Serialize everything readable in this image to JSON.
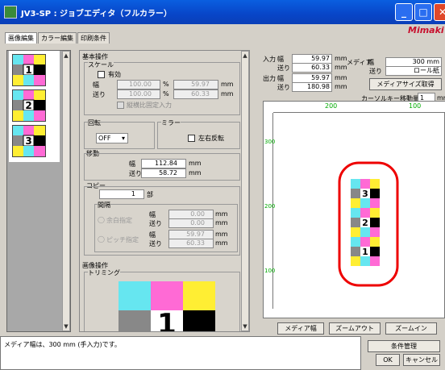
{
  "window": {
    "title": "JV3-SP : ジョブエディタ（フルカラー）",
    "logo": "Mimaki"
  },
  "tabs": [
    {
      "label": "画像編集"
    },
    {
      "label": "カラー編集"
    },
    {
      "label": "印刷条件"
    }
  ],
  "thumbnails": [
    {
      "label": "1"
    },
    {
      "label": "2"
    },
    {
      "label": "3"
    }
  ],
  "basic": {
    "section_title": "基本操作",
    "scale": {
      "title": "スケール",
      "enabled_label": "有効",
      "width_label": "幅",
      "feed_label": "送り",
      "width_pct": "100.00",
      "feed_pct": "100.00",
      "width_mm": "59.97",
      "feed_mm": "60.33",
      "pct_unit": "%",
      "mm_unit": "mm",
      "fixed_ratio_label": "縦横比固定入力"
    },
    "rotate": {
      "title": "回転",
      "value": "OFF"
    },
    "mirror": {
      "title": "ミラー",
      "label": "左右反転"
    },
    "move": {
      "title": "移動",
      "width_label": "幅",
      "feed_label": "送り",
      "width_value": "112.84",
      "feed_value": "58.72",
      "unit": "mm"
    },
    "copy": {
      "title": "コピー",
      "count": "1",
      "count_unit": "部",
      "spacing_title": "間隔",
      "auto_label": "余白指定",
      "pitch_label": "ピッチ指定",
      "width_label": "幅",
      "feed_label": "送り",
      "auto_width": "0.00",
      "auto_feed": "0.00",
      "pitch_width": "59.97",
      "pitch_feed": "60.33",
      "unit": "mm"
    }
  },
  "image_ops": {
    "title": "画像操作",
    "trimming_title": "トリミング",
    "trim_number": "1"
  },
  "size_info": {
    "input_label": "入力",
    "output_label": "出力",
    "width_label": "幅",
    "feed_label": "送り",
    "input_width": "59.97",
    "input_feed": "60.33",
    "output_width": "59.97",
    "output_feed": "180.98",
    "unit": "mm"
  },
  "media": {
    "label": "メディア",
    "width_label": "幅",
    "feed_label": "送り",
    "width_value": "300 mm",
    "feed_value": "ロール紙",
    "get_size_button": "メディアサイズ取得"
  },
  "cursor": {
    "label": "カーソルキー移動量",
    "value": "1",
    "unit": "mm"
  },
  "ruler": {
    "h_ticks": [
      "200",
      "100"
    ],
    "v_ticks": [
      "300",
      "200",
      "100"
    ]
  },
  "preview_tiles": [
    "3",
    "2",
    "1"
  ],
  "preview_buttons": {
    "media_width": "メディア幅",
    "zoom_out": "ズームアウト",
    "zoom_in": "ズームイン"
  },
  "status": {
    "message": "メディア幅は、300 mm (手入力)です。"
  },
  "footer_buttons": {
    "conditions": "条件管理",
    "ok": "OK",
    "cancel": "キャンセル"
  }
}
